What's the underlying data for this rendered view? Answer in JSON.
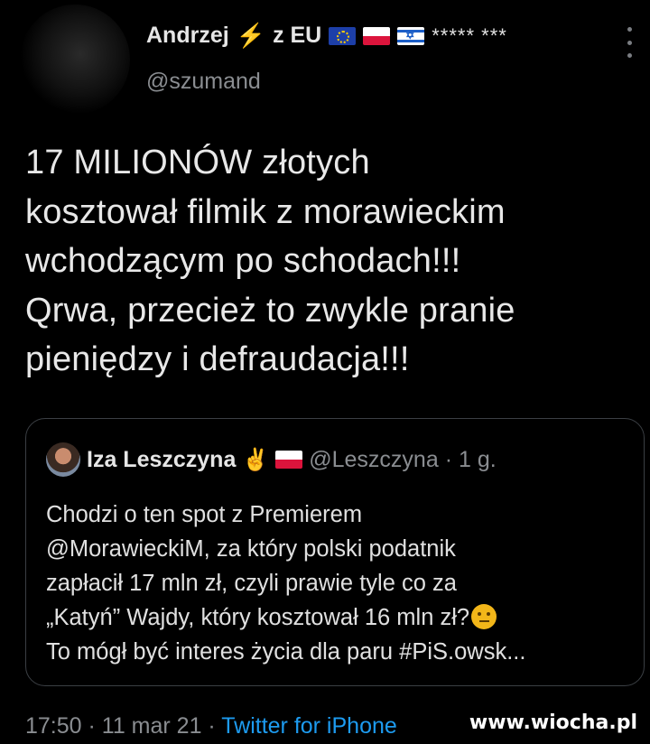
{
  "author": {
    "name": "Andrzej",
    "name_suffix": "z EU",
    "stars": "***** ***",
    "handle": "@szumand",
    "icons": [
      "lightning-icon",
      "eu-flag-icon",
      "poland-flag-icon",
      "israel-flag-icon"
    ]
  },
  "tweet": {
    "text": "17 MILIONÓW złotych\nkosztował filmik z morawieckim\nwchodzącym po schodach!!!\nQrwa, przecież to zwykle pranie\npieniędzy i defraudacja!!!"
  },
  "quoted": {
    "name": "Iza Leszczyna",
    "handle": "@Leszczyna",
    "time": "· 1 g.",
    "text": "Chodzi o ten spot z Premierem\n@MorawieckiM, za który polski podatnik\nzapłacił 17 mln zł, czyli prawie tyle co za\n„Katyń” Wajdy, który kosztował 16 mln zł?",
    "text_end": "\nTo mógł być interes życia dla paru #PiS.owsk..."
  },
  "meta": {
    "time": "17:50 · 11 mar 21 · ",
    "source": "Twitter for iPhone"
  },
  "watermark": "www.wiocha.pl"
}
